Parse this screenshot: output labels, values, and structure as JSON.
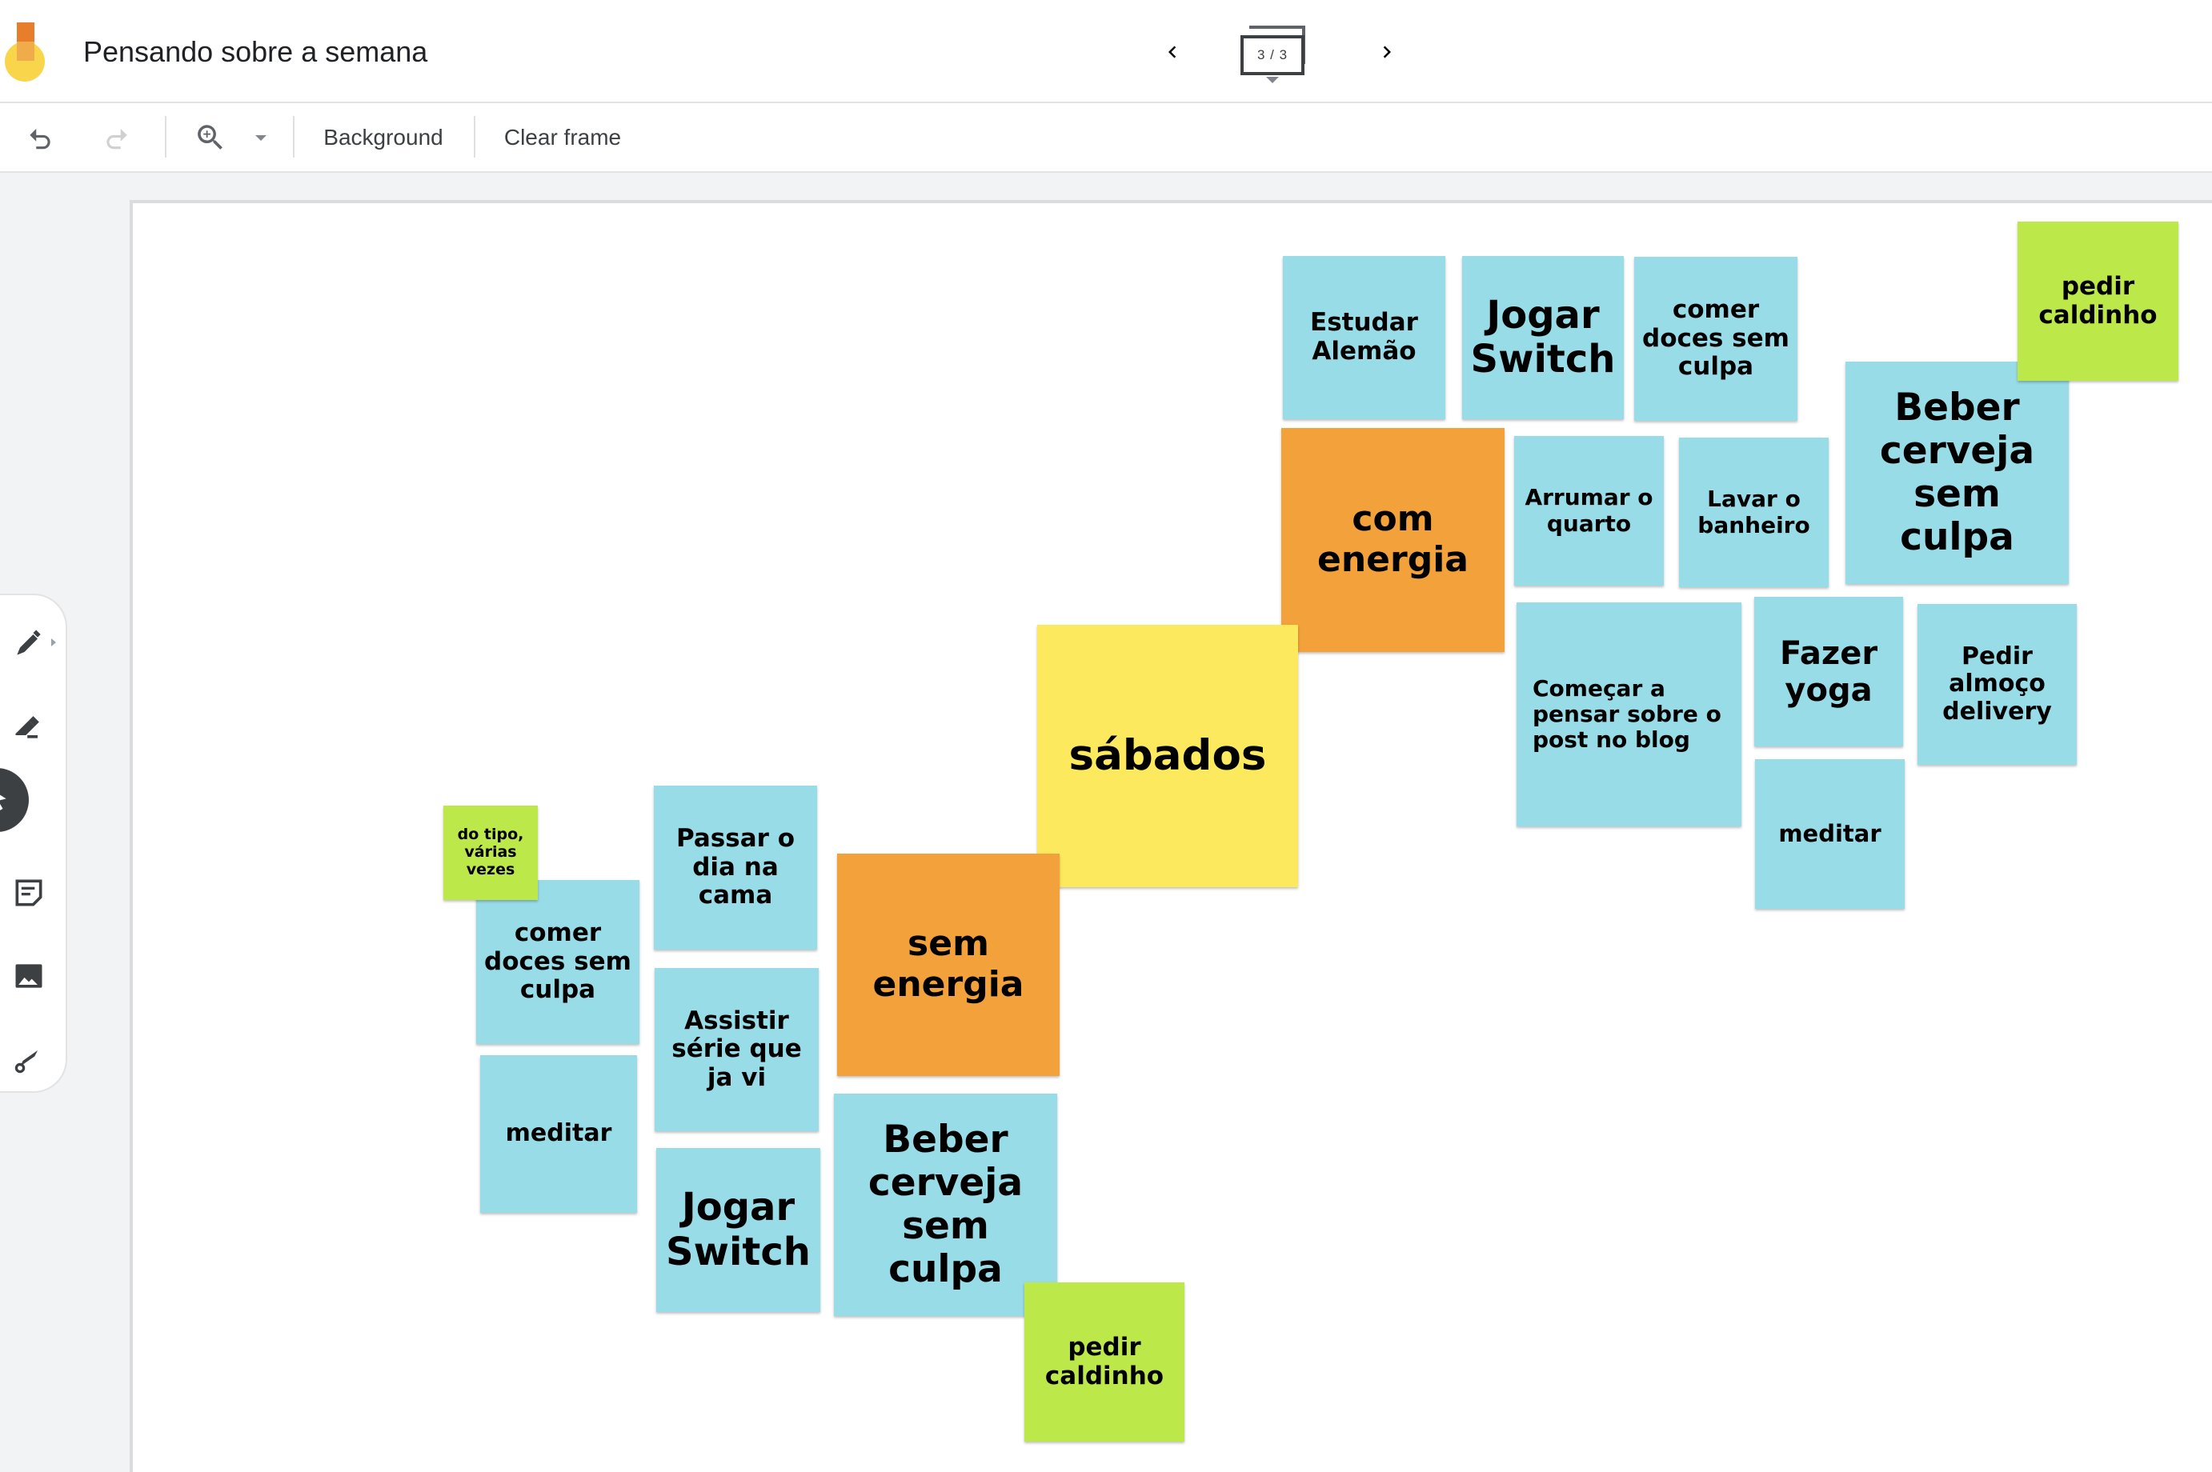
{
  "app": {
    "title": "Pensando sobre a semana",
    "logo": "jamboard-logo"
  },
  "frame_nav": {
    "prev_icon": "chevron-left-icon",
    "next_icon": "chevron-right-icon",
    "counter": "3 / 3"
  },
  "toolbar": {
    "undo_icon": "undo-icon",
    "redo_icon": "redo-icon",
    "zoom_icon": "zoom-in-icon",
    "zoom_dropdown_icon": "dropdown-arrow-icon",
    "background_label": "Background",
    "clear_frame_label": "Clear frame"
  },
  "side_tools": [
    {
      "name": "pen",
      "icon": "pen-icon",
      "active": false
    },
    {
      "name": "eraser",
      "icon": "eraser-icon",
      "active": false
    },
    {
      "name": "select",
      "icon": "pointer-icon",
      "active": true
    },
    {
      "name": "sticky-note",
      "icon": "sticky-note-icon",
      "active": false
    },
    {
      "name": "image",
      "icon": "image-icon",
      "active": false
    },
    {
      "name": "laser",
      "icon": "laser-icon",
      "active": false
    }
  ],
  "colors": {
    "blue": "#98dce8",
    "orange": "#f3a13a",
    "yellow": "#fde95e",
    "green": "#bce849"
  },
  "notes": [
    {
      "text": "Estudar Alemão",
      "color": "blue"
    },
    {
      "text": "Jogar Switch",
      "color": "blue"
    },
    {
      "text": "comer doces sem culpa",
      "color": "blue"
    },
    {
      "text": "pedir caldinho",
      "color": "green"
    },
    {
      "text": "Beber cerveja sem culpa",
      "color": "blue"
    },
    {
      "text": "com energia",
      "color": "orange"
    },
    {
      "text": "Arrumar o quarto",
      "color": "blue"
    },
    {
      "text": "Lavar o banheiro",
      "color": "blue"
    },
    {
      "text": "Começar a pensar sobre o post no blog",
      "color": "blue"
    },
    {
      "text": "Fazer yoga",
      "color": "blue"
    },
    {
      "text": "Pedir almoço delivery",
      "color": "blue"
    },
    {
      "text": "meditar",
      "color": "blue"
    },
    {
      "text": "sábados",
      "color": "yellow"
    },
    {
      "text": "sem energia",
      "color": "orange"
    },
    {
      "text": "Passar o dia na cama",
      "color": "blue"
    },
    {
      "text": "comer doces sem culpa",
      "color": "blue"
    },
    {
      "text": "do tipo, várias vezes",
      "color": "green"
    },
    {
      "text": "Assistir série que ja vi",
      "color": "blue"
    },
    {
      "text": "meditar",
      "color": "blue"
    },
    {
      "text": "Jogar Switch",
      "color": "blue"
    },
    {
      "text": "Beber cerveja sem culpa",
      "color": "blue"
    },
    {
      "text": "pedir caldinho",
      "color": "green"
    }
  ]
}
